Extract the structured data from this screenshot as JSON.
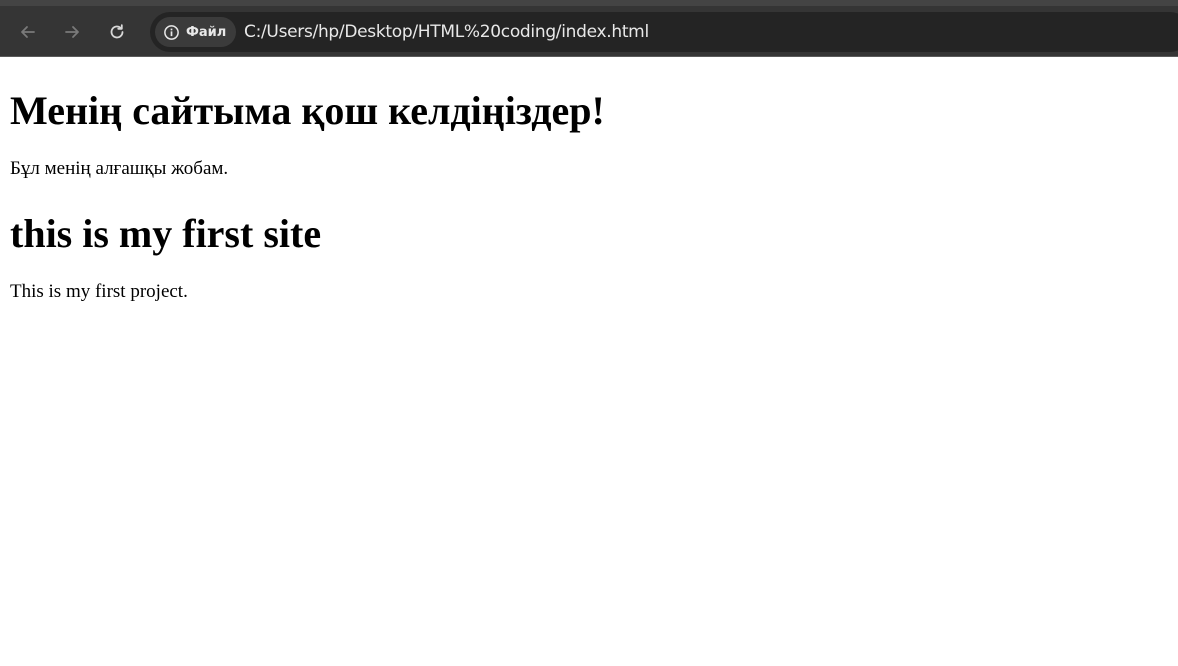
{
  "browser": {
    "security_chip": {
      "icon": "info-icon",
      "label": "Файл"
    },
    "address_bar": {
      "url": "C:/Users/hp/Desktop/HTML%20coding/index.html"
    },
    "nav": {
      "back_icon": "arrow-left-icon",
      "forward_icon": "arrow-right-icon",
      "reload_icon": "reload-icon"
    },
    "colors": {
      "toolbar": "#353535",
      "omnibox": "#242424",
      "chip": "#3b3b3b",
      "text": "#e8e8e8"
    }
  },
  "page": {
    "heading_kz": "Менің сайтыма қош келдіңіздер!",
    "paragraph_kz": "Бұл менің алғашқы жобам.",
    "heading_en": "this is my first site",
    "paragraph_en": "This is my first project."
  }
}
